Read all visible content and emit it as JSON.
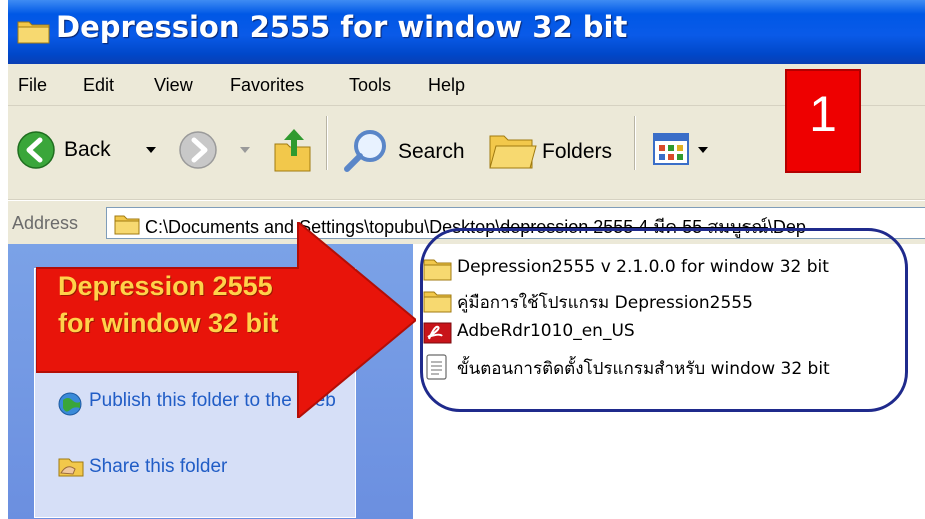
{
  "window": {
    "title": "Depression 2555 for window 32 bit"
  },
  "menu": {
    "items": [
      "File",
      "Edit",
      "View",
      "Favorites",
      "Tools",
      "Help"
    ]
  },
  "toolbar": {
    "back_label": "Back",
    "search_label": "Search",
    "folders_label": "Folders"
  },
  "address": {
    "label": "Address",
    "path_visible": "C:\\Documents and Settings\\topubu\\Desktop\\",
    "path_strike": "depression 2555  4 มีค 55 สมบูรณ์",
    "path_tail": "\\Dep"
  },
  "tasks": {
    "items": [
      {
        "label": "Publish this folder to the Web",
        "icon": "globe-publish-icon"
      },
      {
        "label": "Share this folder",
        "icon": "share-folder-icon"
      }
    ]
  },
  "files": [
    {
      "name": "Depression2555 v 2.1.0.0 for window 32 bit",
      "icon": "folder-icon"
    },
    {
      "name": "คู่มือการใช้โปรแกรม Depression2555",
      "icon": "folder-icon"
    },
    {
      "name": "AdbeRdr1010_en_US",
      "icon": "adobe-reader-icon"
    },
    {
      "name": "ขั้นตอนการติดตั้งโปรแกรมสำหรับ window 32  bit",
      "icon": "text-document-icon"
    }
  ],
  "annotation": {
    "callout_line1": "Depression 2555",
    "callout_line2": "for window 32 bit",
    "step_number": "1"
  },
  "colors": {
    "titlebar": "#0058e6",
    "callout_arrow": "#e8140a",
    "callout_text": "#ffd24a",
    "step_box": "#ee0000",
    "highlight_oval": "#1f2a8c"
  }
}
